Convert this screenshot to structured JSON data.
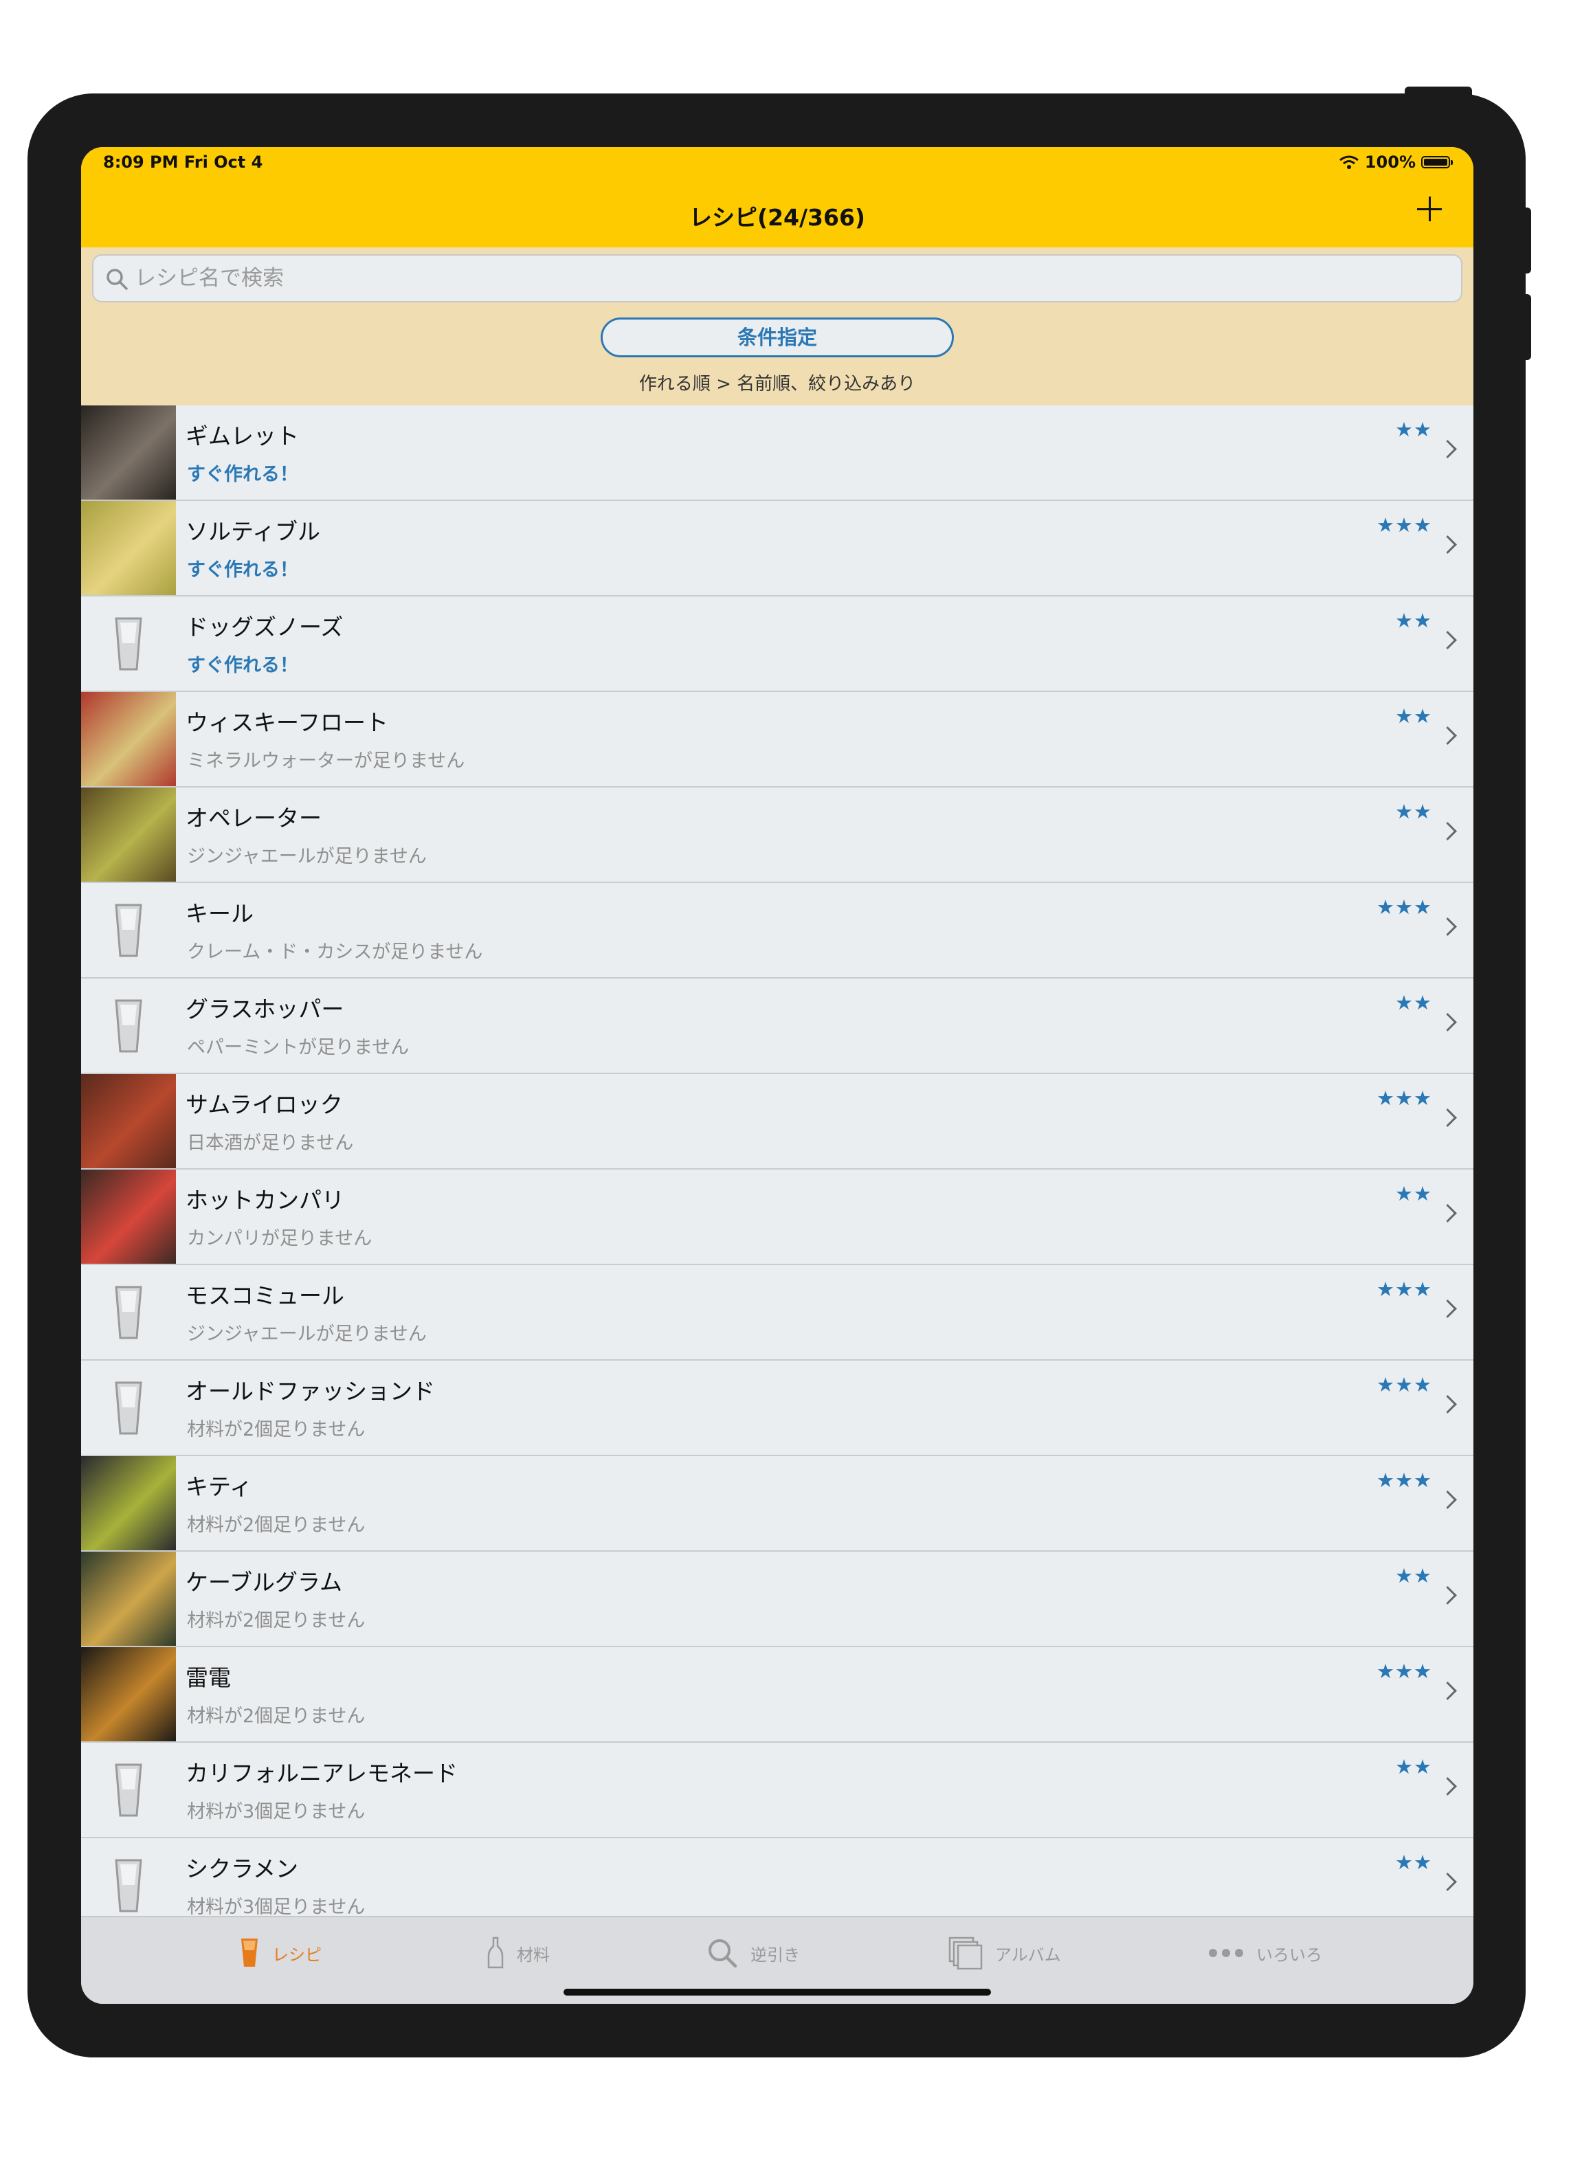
{
  "status_bar": {
    "time": "8:09 PM  Fri Oct 4",
    "battery": "100%"
  },
  "nav": {
    "title": "レシピ(24/366)",
    "add_icon": "plus-icon"
  },
  "search": {
    "placeholder": "レシピ名で検索",
    "value": ""
  },
  "filter": {
    "button_label": "条件指定",
    "sort_text": "作れる順 > 名前順、絞り込みあり"
  },
  "recipes": [
    {
      "name": "ギムレット",
      "status": "すぐ作れる！",
      "makeable": true,
      "stars": "★★",
      "photo": true,
      "c1": "#2a2520",
      "c2": "#7c7268"
    },
    {
      "name": "ソルティブル",
      "status": "すぐ作れる！",
      "makeable": true,
      "stars": "★★★",
      "photo": true,
      "c1": "#a9a040",
      "c2": "#e6d380"
    },
    {
      "name": "ドッグズノーズ",
      "status": "すぐ作れる！",
      "makeable": true,
      "stars": "★★",
      "photo": false
    },
    {
      "name": "ウィスキーフロート",
      "status": "ミネラルウォーターが足りません",
      "makeable": false,
      "stars": "★★",
      "photo": true,
      "c1": "#b0392e",
      "c2": "#d8c27a"
    },
    {
      "name": "オペレーター",
      "status": "ジンジャエールが足りません",
      "makeable": false,
      "stars": "★★",
      "photo": true,
      "c1": "#5b4a22",
      "c2": "#b6b24c"
    },
    {
      "name": "キール",
      "status": "クレーム・ド・カシスが足りません",
      "makeable": false,
      "stars": "★★★",
      "photo": false
    },
    {
      "name": "グラスホッパー",
      "status": "ペパーミントが足りません",
      "makeable": false,
      "stars": "★★",
      "photo": false
    },
    {
      "name": "サムライロック",
      "status": "日本酒が足りません",
      "makeable": false,
      "stars": "★★★",
      "photo": true,
      "c1": "#5a2a1c",
      "c2": "#b7482e"
    },
    {
      "name": "ホットカンパリ",
      "status": "カンパリが足りません",
      "makeable": false,
      "stars": "★★",
      "photo": true,
      "c1": "#3c2a24",
      "c2": "#d6463a"
    },
    {
      "name": "モスコミュール",
      "status": "ジンジャエールが足りません",
      "makeable": false,
      "stars": "★★★",
      "photo": false
    },
    {
      "name": "オールドファッションド",
      "status": "材料が2個足りません",
      "makeable": false,
      "stars": "★★★",
      "photo": false
    },
    {
      "name": "キティ",
      "status": "材料が2個足りません",
      "makeable": false,
      "stars": "★★★",
      "photo": true,
      "c1": "#2a2a30",
      "c2": "#a8b23a"
    },
    {
      "name": "ケーブルグラム",
      "status": "材料が2個足りません",
      "makeable": false,
      "stars": "★★",
      "photo": true,
      "c1": "#2c3a2c",
      "c2": "#cfa54a"
    },
    {
      "name": "雷電",
      "status": "材料が2個足りません",
      "makeable": false,
      "stars": "★★★",
      "photo": true,
      "c1": "#1e1a16",
      "c2": "#c4852c"
    },
    {
      "name": "カリフォルニアレモネード",
      "status": "材料が3個足りません",
      "makeable": false,
      "stars": "★★",
      "photo": false
    },
    {
      "name": "シクラメン",
      "status": "材料が3個足りません",
      "makeable": false,
      "stars": "★★",
      "photo": false
    }
  ],
  "tabs": [
    {
      "label": "レシピ",
      "icon": "glass-icon",
      "active": true
    },
    {
      "label": "材料",
      "icon": "bottle-icon",
      "active": false
    },
    {
      "label": "逆引き",
      "icon": "search-icon",
      "active": false
    },
    {
      "label": "アルバム",
      "icon": "album-icon",
      "active": false
    },
    {
      "label": "いろいろ",
      "icon": "more-icon",
      "active": false
    }
  ],
  "colors": {
    "nav_bar": "#fecb00",
    "filter_bg": "#f0deb2",
    "accent_blue": "#2a78b5",
    "active_tab": "#e77b1b"
  }
}
